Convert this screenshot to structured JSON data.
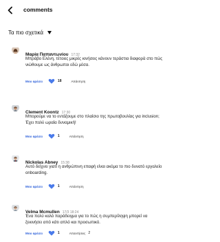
{
  "header": {
    "title": "comments",
    "back_icon": "chevron-left-icon"
  },
  "sort": {
    "label": "Τα πιο σχετικά",
    "icon": "caret-down-icon"
  },
  "colors": {
    "accent": "#2b5fd9",
    "heart": "#4a7bea"
  },
  "comments": [
    {
      "author": "Μαρία Παπαντωνίου",
      "time": "17:32",
      "text": "Μπράβο Ελένη, τέτοιες μικρές κινήσεις κάνουν τεράστια διαφορά στο πώς νιώθουμε ως άνθρωποι εδώ μέσα.",
      "like_label": "Μου αρέσει",
      "likes": "18",
      "reply_label": "Απάντηση",
      "replies": ""
    },
    {
      "author": "Clement Koontz",
      "time": "17:30",
      "text": "Μπορούμε να το εντάξουμε στο πλαίσιο της πρωτοβουλίας για inclusion; Έχει πολύ ωραία δυναμική!",
      "like_label": "Μου αρέσει",
      "likes": "1",
      "reply_label": "Απάντηση",
      "replies": ""
    },
    {
      "author": "Nickolas Abney",
      "time": "15:38",
      "text": "Αυτό δείχνει γιατί η ανθρώπινη επαφή είναι ακόμα το πιο δυνατό εργαλείο onboarding.",
      "like_label": "Μου αρέσει",
      "likes": "1",
      "reply_label": "Απάντηση",
      "replies": ""
    },
    {
      "author": "Velma Mcmullen",
      "time": "17/3 18:24",
      "text": "Ένα πολύ καλό παράδειγμα για το πώς η συμπερίληψη μπορεί να ξεκινήσει από κάτι απλό και προσωπικό.",
      "like_label": "Μου αρέσει",
      "likes": "1",
      "reply_label": "Απαντήσεις",
      "replies": "2"
    }
  ]
}
